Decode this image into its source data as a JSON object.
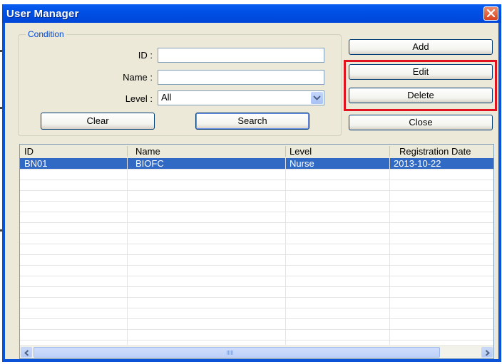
{
  "window": {
    "title": "User Manager"
  },
  "condition": {
    "legend": "Condition",
    "id_label": "ID :",
    "id_value": "",
    "name_label": "Name :",
    "name_value": "",
    "level_label": "Level :",
    "level_value": "All"
  },
  "buttons": {
    "clear": "Clear",
    "search": "Search",
    "add": "Add",
    "edit": "Edit",
    "delete": "Delete",
    "close": "Close"
  },
  "list": {
    "columns": [
      "ID",
      "Name",
      "Level",
      "Registration Date"
    ],
    "rows": [
      [
        "BN01",
        "BIOFC",
        "Nurse",
        "2013-10-22"
      ]
    ]
  },
  "colors": {
    "title_bar": "#0050e6",
    "selection": "#316ac5",
    "highlight": "#e0141e"
  },
  "icons": [
    "close-icon",
    "dropdown-arrow-icon",
    "scroll-left-icon",
    "scroll-right-icon"
  ]
}
